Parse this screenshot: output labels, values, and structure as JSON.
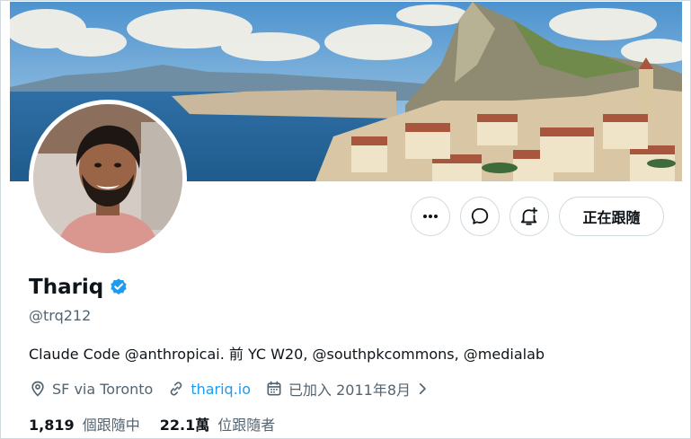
{
  "profile": {
    "display_name": "Thariq",
    "handle": "@trq212",
    "verified_icon": "verified-badge-icon",
    "bio": "Claude Code @anthropicai. 前 YC W20, @southpkcommons, @medialab",
    "location": "SF via Toronto",
    "website": "thariq.io",
    "joined": "已加入 2011年8月"
  },
  "actions": {
    "more_icon": "more-horizontal-icon",
    "message_icon": "message-bubble-icon",
    "notify_icon": "bell-plus-icon",
    "following_label": "正在跟隨"
  },
  "stats": {
    "following_count": "1,819",
    "following_label": "個跟隨中",
    "followers_count": "22.1萬",
    "followers_label": "位跟隨者"
  },
  "colors": {
    "accent": "#1d9bf0",
    "secondary_text": "#536471",
    "primary_text": "#0f1419",
    "border": "#cfd9de"
  }
}
